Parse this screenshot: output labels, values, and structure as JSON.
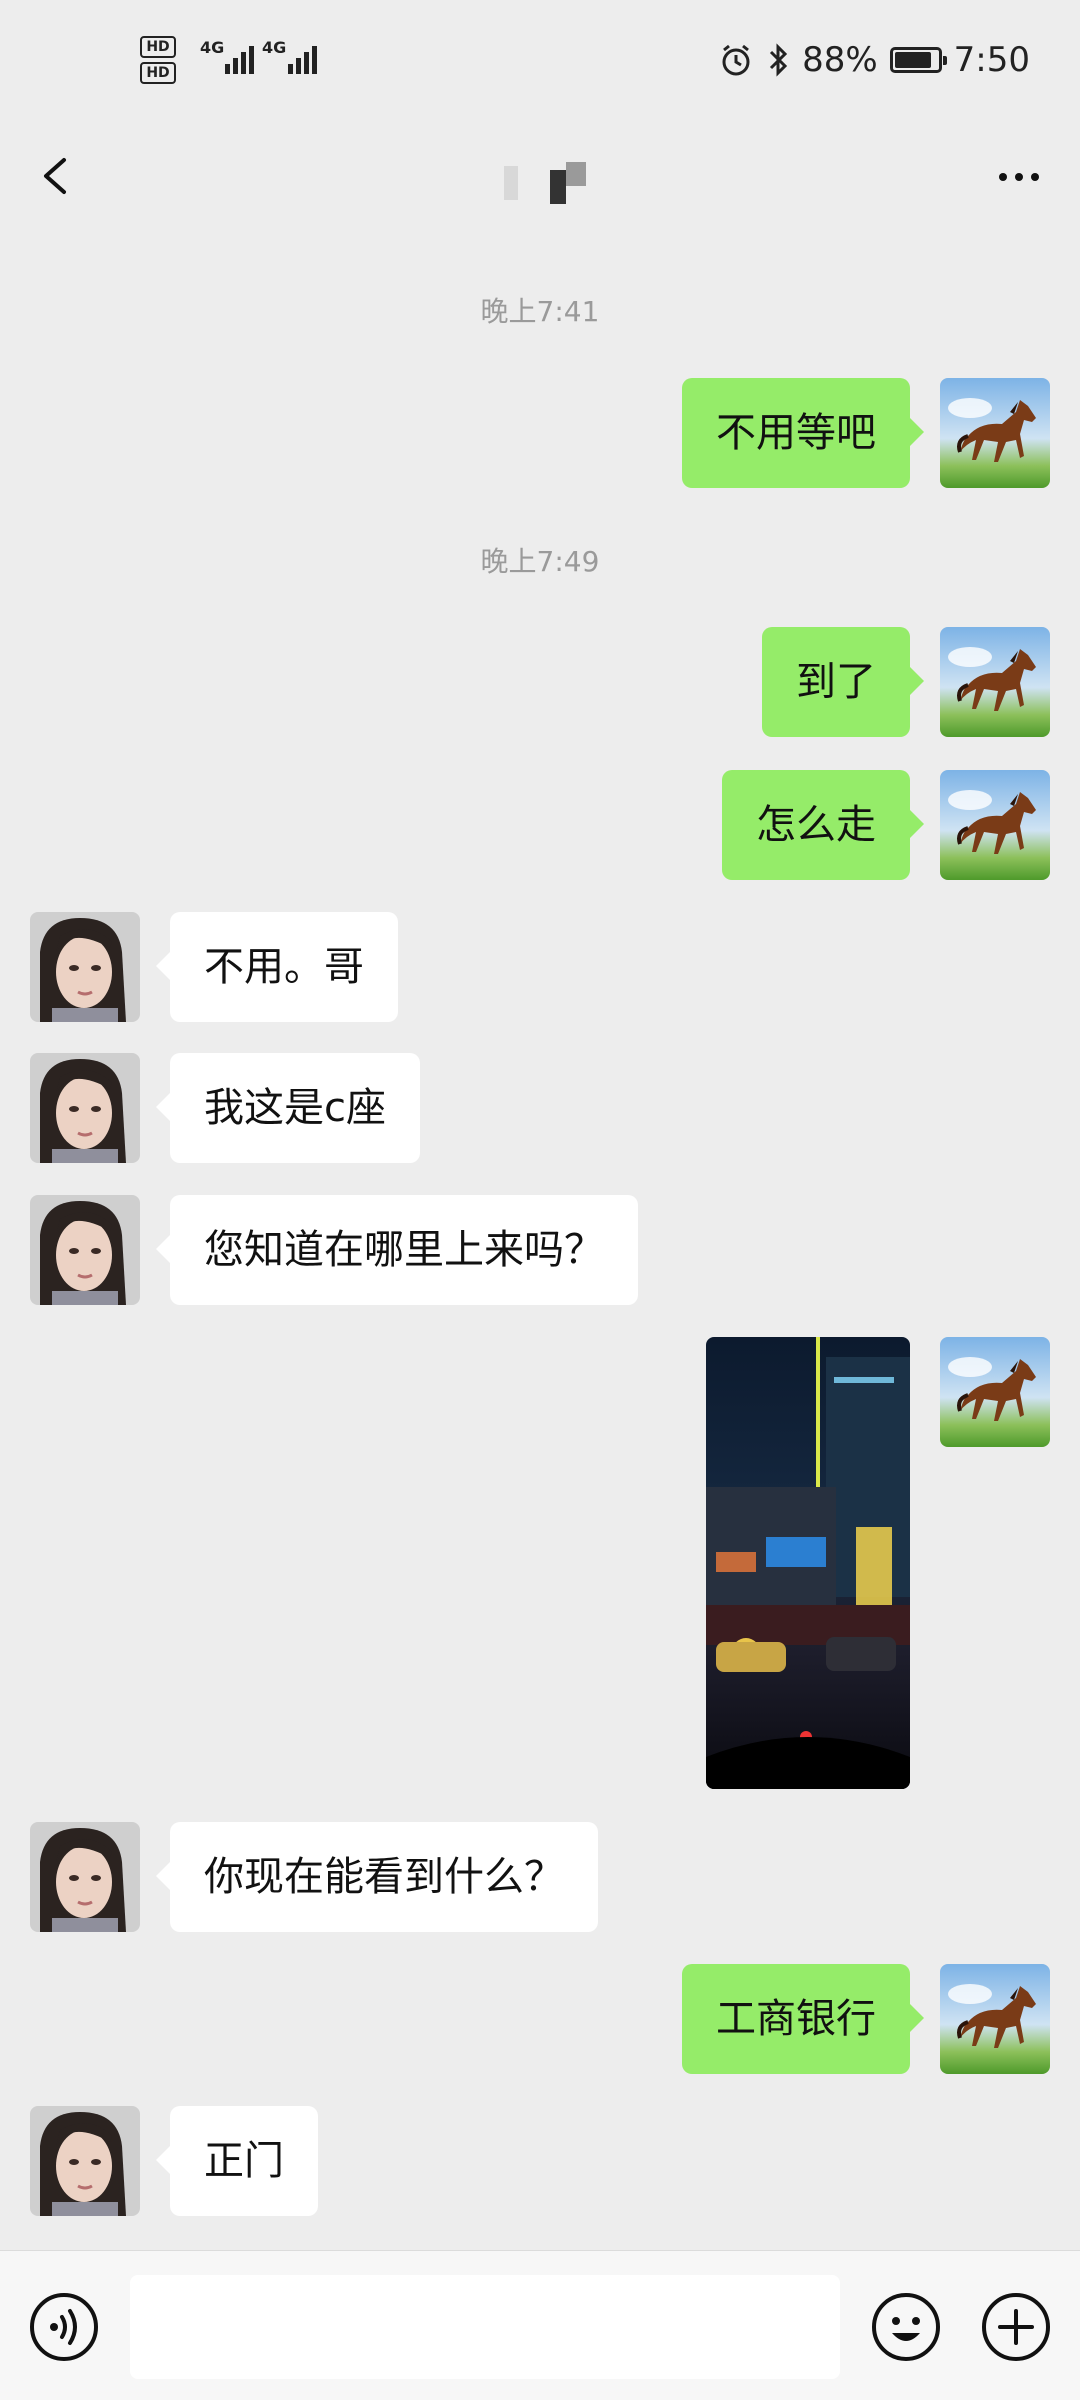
{
  "statusbar": {
    "hd1": "HD",
    "hd2": "HD",
    "net1": "4G",
    "net2": "4G",
    "battery_text": "88%",
    "time": "7:50"
  },
  "navbar": {
    "title": ""
  },
  "messages": {
    "ts1": "晚上7:41",
    "m1": "不用等吧",
    "ts2": "晚上7:49",
    "m2": "到了",
    "m3": "怎么走",
    "m4": "不用。哥",
    "m5": "我这是c座",
    "m6": "您知道在哪里上来吗？",
    "m7": "你现在能看到什么？",
    "m8": "工商银行",
    "m9": "正门"
  },
  "input": {
    "placeholder": ""
  },
  "colors": {
    "my_bubble": "#95ec69",
    "their_bubble": "#ffffff",
    "background": "#ededed"
  }
}
